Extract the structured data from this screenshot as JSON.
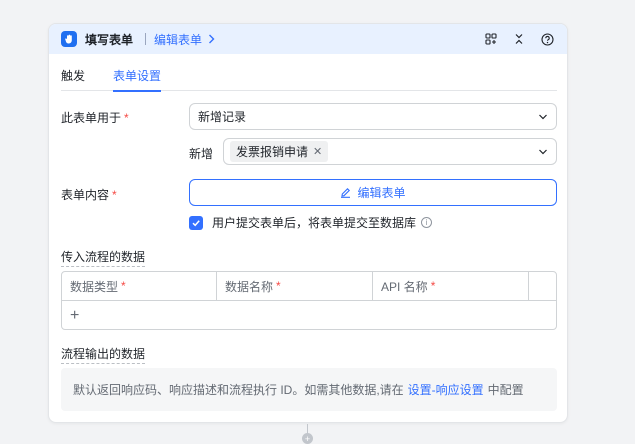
{
  "header": {
    "title": "填写表单",
    "edit_link": "编辑表单",
    "icons": [
      "hand-icon",
      "layout-icon",
      "collapse-icon",
      "help-icon"
    ]
  },
  "tabs": [
    {
      "label": "触发",
      "active": false
    },
    {
      "label": "表单设置",
      "active": true
    }
  ],
  "form_usage": {
    "label": "此表单用于",
    "required_mark": "*",
    "value": "新增记录"
  },
  "add_record": {
    "label": "新增",
    "tag": "发票报销申请"
  },
  "form_content": {
    "label": "表单内容",
    "required_mark": "*",
    "edit_button": "编辑表单"
  },
  "submit_option": {
    "checked": true,
    "text": "用户提交表单后，将表单提交至数据库"
  },
  "input_data": {
    "title": "传入流程的数据",
    "columns": [
      {
        "label": "数据类型",
        "required_mark": "*"
      },
      {
        "label": "数据名称",
        "required_mark": "*"
      },
      {
        "label": "API 名称",
        "required_mark": "*"
      },
      {
        "label": "",
        "required_mark": ""
      }
    ],
    "add_symbol": "+"
  },
  "output_data": {
    "title": "流程输出的数据",
    "text_before": "默认返回响应码、响应描述和流程执行 ID。如需其他数据,请在",
    "link": "设置-响应设置",
    "text_after": "中配置"
  },
  "colors": {
    "accent": "#3370ff",
    "header_bg": "#e8f1ff",
    "required": "#f54a45"
  }
}
